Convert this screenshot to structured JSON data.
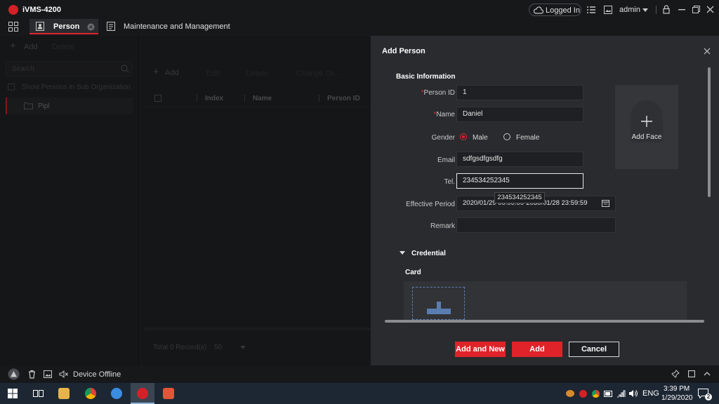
{
  "app": {
    "title": "iVMS-4200"
  },
  "titlebar": {
    "logged_in": "Logged In",
    "user": "admin"
  },
  "tabs": [
    {
      "label": "Person"
    },
    {
      "label": "Maintenance and Management"
    }
  ],
  "left": {
    "add": "Add",
    "delete": "Delete",
    "search_placeholder": "Search",
    "show_sub": "Show Persons in Sub Organization",
    "org": "Pipl"
  },
  "center": {
    "toolbar": {
      "add": "Add",
      "edit": "Edit",
      "delete": "Delete",
      "change_org": "Change Or..."
    },
    "columns": [
      "Index",
      "Name",
      "Person ID"
    ],
    "total": "Total 0 Record(s)",
    "page_size": "50"
  },
  "dialog": {
    "title": "Add Person",
    "section_basic": "Basic Information",
    "person_id_label": "Person ID",
    "person_id_value": "1",
    "name_label": "Name",
    "name_value": "Daniel",
    "gender_label": "Gender",
    "gender_male": "Male",
    "gender_female": "Female",
    "gender_selected": "Male",
    "email_label": "Email",
    "email_value": "sdfgsdfgsdfg",
    "tel_label": "Tel.",
    "tel_value": "234534252345",
    "tooltip": "234534252345",
    "period_label": "Effective Period",
    "period_value": "2020/01/29 00:00:00-2030/01/28 23:59:59",
    "remark_label": "Remark",
    "add_face": "Add Face",
    "section_credential": "Credential",
    "card_label": "Card",
    "btn_add_new": "Add and New",
    "btn_add": "Add",
    "btn_cancel": "Cancel"
  },
  "status": {
    "device": "Device Offline"
  },
  "taskbar": {
    "time": "3:39 PM",
    "date": "1/29/2020",
    "lang": "ENG",
    "notifications": "2"
  },
  "colors": {
    "accent": "#e0232a",
    "bg": "#1b1c1e",
    "dialog": "#2a2b2e"
  }
}
